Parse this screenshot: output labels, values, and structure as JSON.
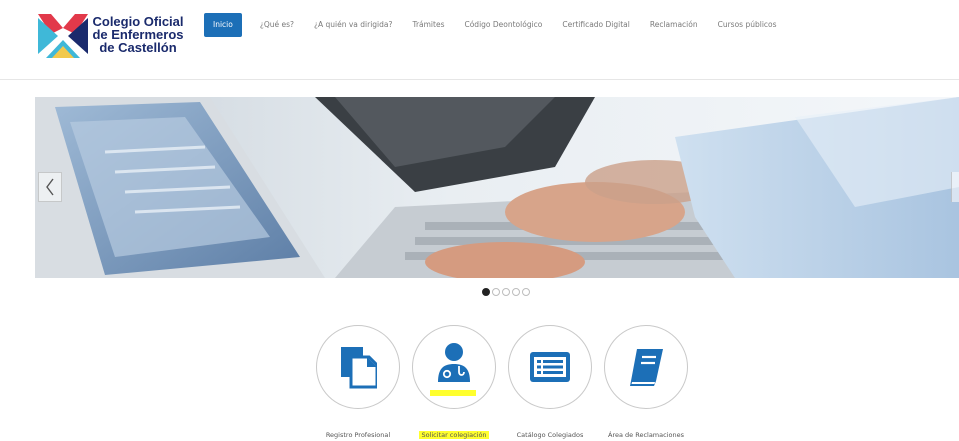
{
  "logo": {
    "line1": "Colegio Oficial",
    "line2": "de Enfermeros",
    "line3": "de Castellón",
    "colors": {
      "red": "#e2394a",
      "cyan": "#3fb8d8",
      "navy": "#1a2a6c",
      "yellow": "#f2c94c"
    }
  },
  "nav": {
    "items": [
      {
        "label": "Inicio",
        "active": true
      },
      {
        "label": "¿Qué es?"
      },
      {
        "label": "¿A quién va dirigida?"
      },
      {
        "label": "Trámites"
      },
      {
        "label": "Código Deontológico"
      },
      {
        "label": "Certificado Digital"
      },
      {
        "label": "Reclamación"
      },
      {
        "label": "Cursos públicos"
      }
    ],
    "accent": "#1c6fb7"
  },
  "slider": {
    "image_icon": "hands-typing-keyboard-photo",
    "prev_icon": "chevron-left-icon",
    "next_icon": "chevron-right-icon",
    "total_slides": 5,
    "active_slide": 1
  },
  "services": {
    "items": [
      {
        "label": "Registro Profesional",
        "icon": "documents-icon"
      },
      {
        "label": "Solicitar colegiación",
        "icon": "doctor-icon",
        "highlighted": true
      },
      {
        "label": "Catálogo Colegiados",
        "icon": "list-icon"
      },
      {
        "label": "Área de Reclamaciones",
        "icon": "book-icon"
      }
    ],
    "icon_color": "#1c6fb7",
    "highlight_color": "#ffff2e"
  }
}
